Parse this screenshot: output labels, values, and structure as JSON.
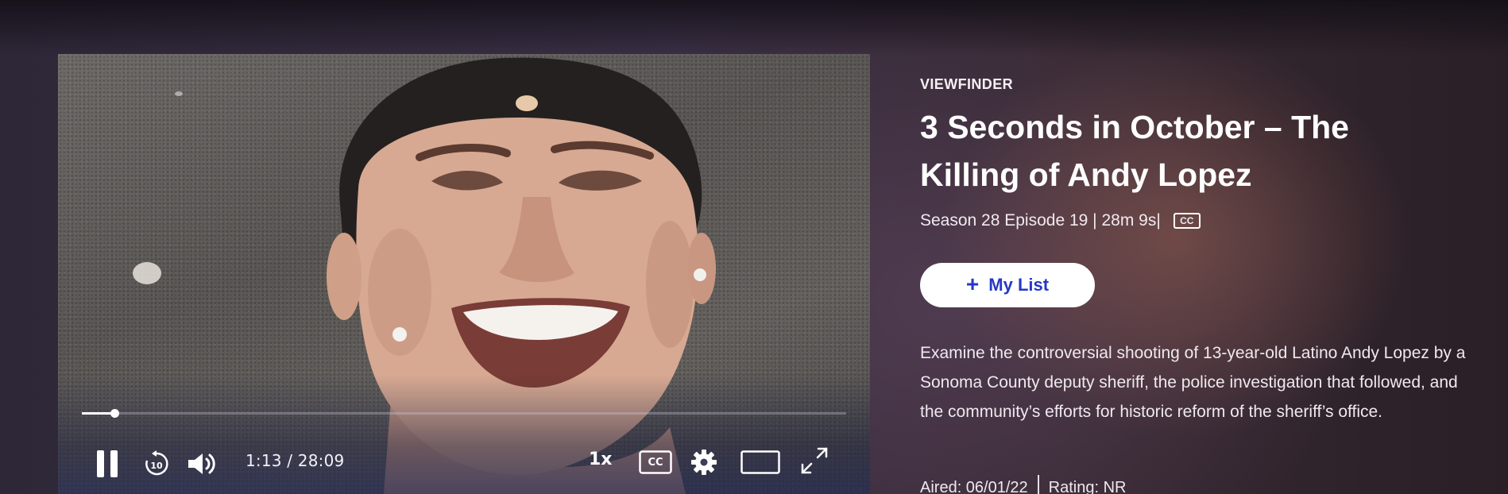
{
  "player": {
    "current_time": "1:13",
    "separator": "/",
    "duration": "28:09",
    "progress_fraction": 0.043,
    "speed_label": "1x",
    "cc_label": "CC"
  },
  "info": {
    "show_label": "VIEWFINDER",
    "title": "3 Seconds in October – The Killing of Andy Lopez",
    "meta": "Season 28 Episode 19 | 28m 9s|",
    "cc_badge": "CC",
    "my_list_plus": "+",
    "my_list_label": "My List",
    "description": "Examine the controversial shooting of 13-year-old Latino Andy Lopez by a Sonoma County deputy sheriff, the police investigation that followed, and the community’s efforts for historic reform of the sheriff’s office.",
    "aired": "Aired: 06/01/22",
    "rating": "Rating: NR"
  },
  "colors": {
    "button_text": "#2638c4",
    "button_bg": "#ffffff"
  },
  "icons": {
    "pause": "pause-icon",
    "rewind": "rewind-10-icon",
    "volume": "volume-icon",
    "captions": "closed-captions-icon",
    "settings": "gear-icon",
    "theater": "theater-mode-icon",
    "fullscreen": "fullscreen-icon"
  }
}
